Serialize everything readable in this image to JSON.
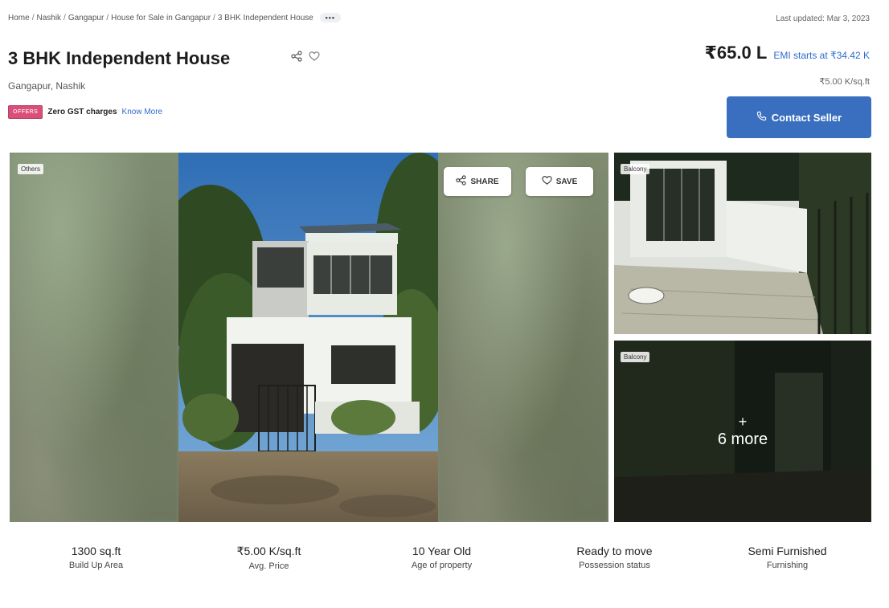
{
  "breadcrumb": {
    "items": [
      "Home",
      "Nashik",
      "Gangapur",
      "House for Sale in Gangapur",
      "3 BHK Independent House"
    ],
    "more": "•••"
  },
  "last_updated": "Last updated: Mar 3, 2023",
  "listing": {
    "title": "3 BHK Independent House",
    "location": "Gangapur, Nashik",
    "price": "₹65.0 L",
    "emi": "EMI starts at ₹34.42 K",
    "price_per_sqft": "₹5.00 K/sq.ft"
  },
  "offers": {
    "badge": "OFFERS",
    "text": "Zero GST charges",
    "link": "Know More"
  },
  "contact_button": "Contact Seller",
  "gallery": {
    "main_tag": "Others",
    "share_label": "SHARE",
    "save_label": "SAVE",
    "side_top_tag": "Balcony",
    "side_bottom_tag": "Balcony",
    "more_plus": "+",
    "more_label": "6 more"
  },
  "stats": [
    {
      "value": "1300 sq.ft",
      "label": "Build Up Area"
    },
    {
      "value": "₹5.00 K/sq.ft",
      "label": "Avg. Price"
    },
    {
      "value": "10 Year Old",
      "label": "Age of property"
    },
    {
      "value": "Ready to move",
      "label": "Possession status"
    },
    {
      "value": "Semi Furnished",
      "label": "Furnishing"
    }
  ],
  "colors": {
    "accent": "#3a6fc0",
    "link": "#2f6ad1",
    "offers_badge": "#d94f79"
  }
}
